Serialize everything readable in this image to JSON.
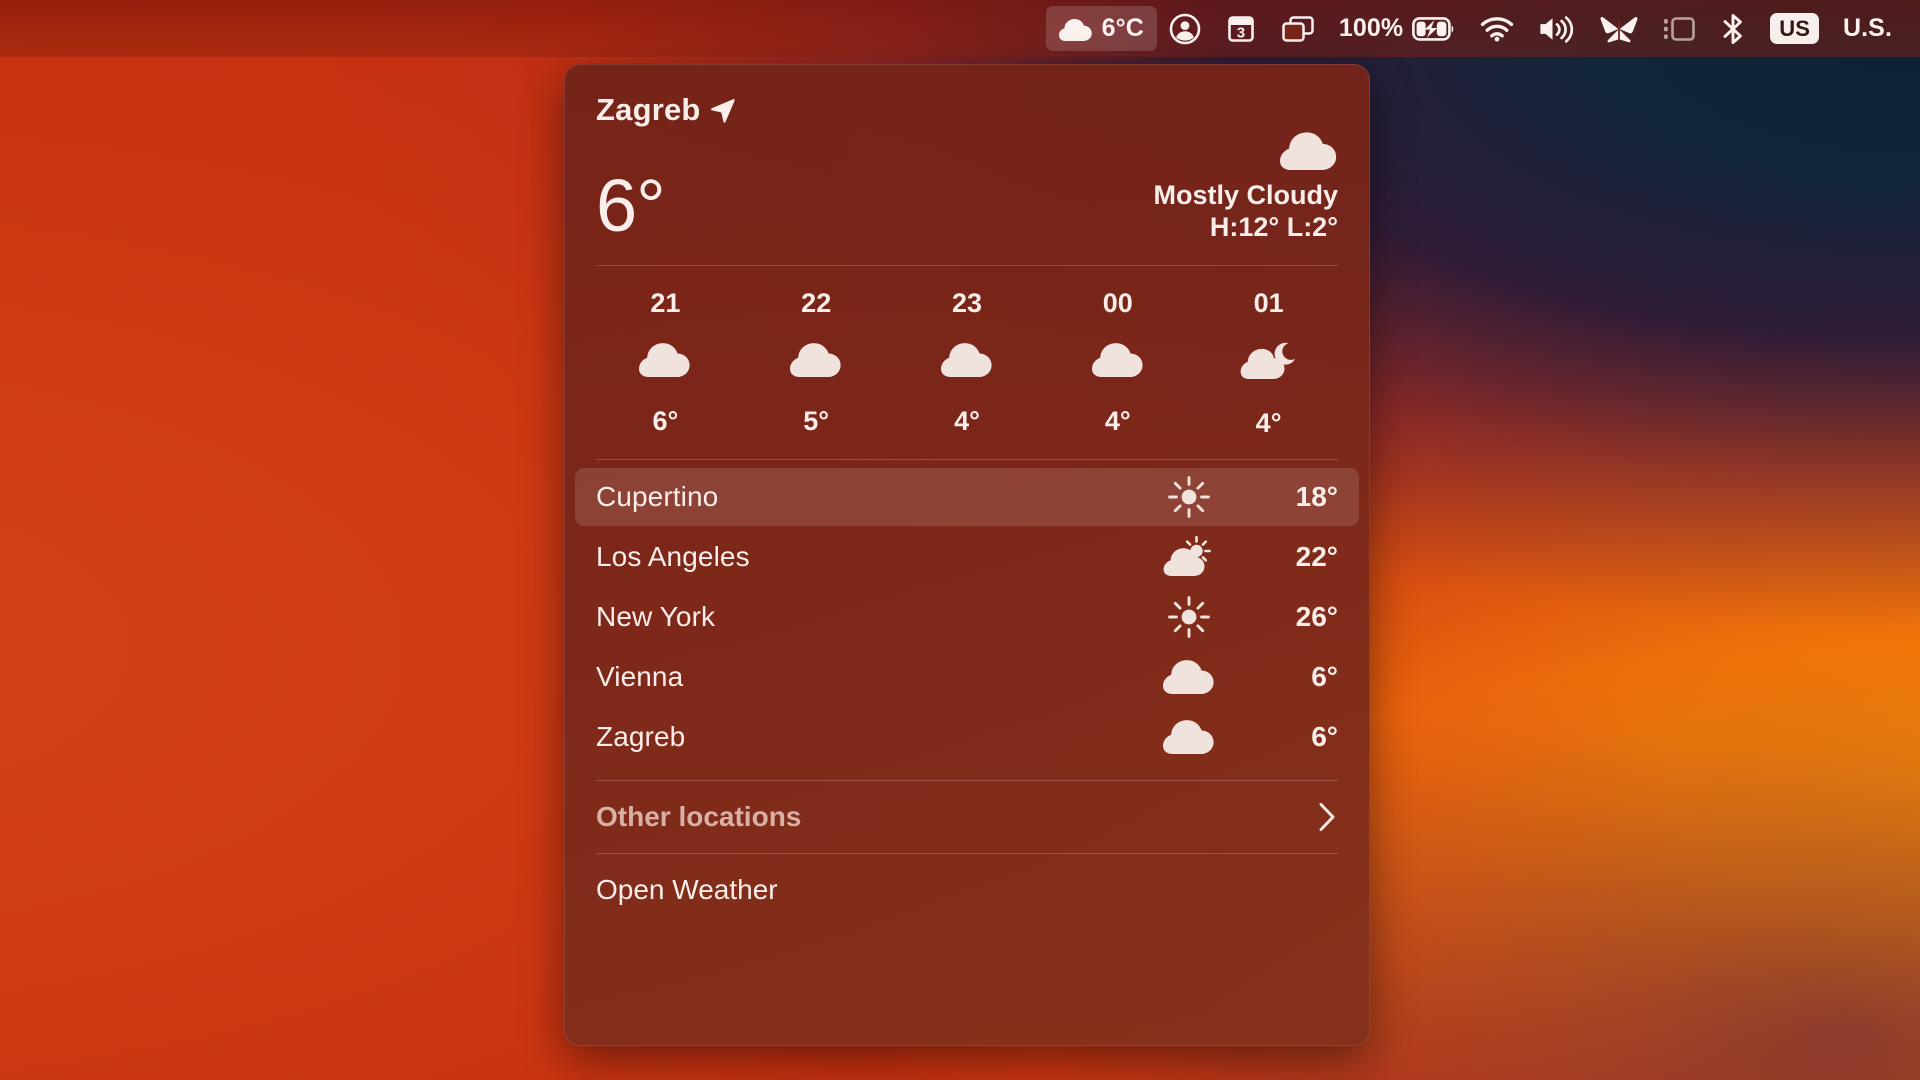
{
  "menubar": {
    "weather_status": {
      "label": "6°C",
      "icon": "cloud-icon",
      "active": true
    },
    "items": [
      {
        "name": "control-center-user",
        "icon": "user-circle-icon",
        "label": ""
      },
      {
        "name": "calendar",
        "icon": "calendar-icon",
        "label": "3"
      },
      {
        "name": "mission-control",
        "icon": "windows-stack-icon",
        "label": ""
      },
      {
        "name": "battery",
        "icon": "battery-charging-icon",
        "label": "100%"
      },
      {
        "name": "wifi",
        "icon": "wifi-icon",
        "label": ""
      },
      {
        "name": "volume",
        "icon": "speaker-waves-icon",
        "label": ""
      },
      {
        "name": "butterfly",
        "icon": "butterfly-icon",
        "label": ""
      },
      {
        "name": "display-layout",
        "icon": "sidebar-layout-icon",
        "label": ""
      },
      {
        "name": "bluetooth",
        "icon": "bluetooth-icon",
        "label": ""
      }
    ],
    "input_source": {
      "badge": "US",
      "label": "U.S."
    },
    "calendar_day": "3",
    "battery_percent": "100%"
  },
  "weather_panel": {
    "location": "Zagreb",
    "location_icon": "location-arrow-icon",
    "current_temp": "6°",
    "condition": "Mostly Cloudy",
    "condition_icon": "cloud-icon",
    "high_low": "H:12° L:2°",
    "hourly": [
      {
        "hour": "21",
        "icon": "cloud-icon",
        "temp": "6°"
      },
      {
        "hour": "22",
        "icon": "cloud-icon",
        "temp": "5°"
      },
      {
        "hour": "23",
        "icon": "cloud-icon",
        "temp": "4°"
      },
      {
        "hour": "00",
        "icon": "cloud-icon",
        "temp": "4°"
      },
      {
        "hour": "01",
        "icon": "cloud-moon-icon",
        "temp": "4°"
      }
    ],
    "cities": [
      {
        "name": "Cupertino",
        "icon": "sun-icon",
        "temp": "18°",
        "selected": true
      },
      {
        "name": "Los Angeles",
        "icon": "cloud-sun-icon",
        "temp": "22°",
        "selected": false
      },
      {
        "name": "New York",
        "icon": "sun-icon",
        "temp": "26°",
        "selected": false
      },
      {
        "name": "Vienna",
        "icon": "cloud-icon",
        "temp": "6°",
        "selected": false
      },
      {
        "name": "Zagreb",
        "icon": "cloud-icon",
        "temp": "6°",
        "selected": false
      }
    ],
    "other_locations": {
      "label": "Other locations",
      "icon": "chevron-right-icon"
    },
    "open_weather": {
      "label": "Open Weather"
    }
  },
  "colors": {
    "panel_bg": "#79261a",
    "highlight": "#8e463a",
    "text": "#fbeeea",
    "dim_text": "#d8b0a5",
    "wallpaper_red": "#c93410",
    "wallpaper_orange": "#fa7f05",
    "wallpaper_navy": "#10243a"
  }
}
